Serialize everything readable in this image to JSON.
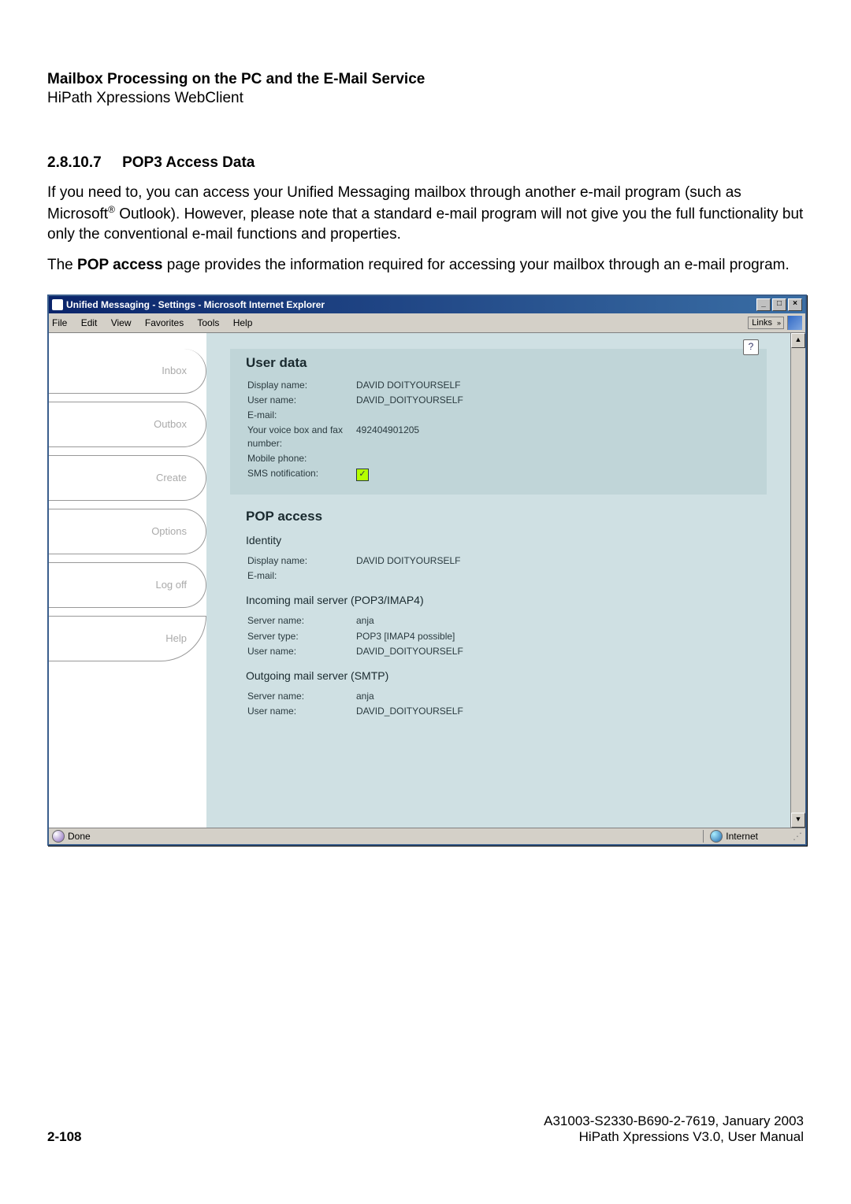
{
  "doc": {
    "chapter_title": "Mailbox Processing on the PC and the E-Mail Service",
    "chapter_sub": "HiPath Xpressions WebClient",
    "section_num": "2.8.10.7",
    "section_title": "POP3 Access Data",
    "para1_a": "If you need to, you can access your Unified Messaging mailbox through another e-mail program (such as Microsoft",
    "para1_sup": "®",
    "para1_b": " Outlook). However, please note that a standard e-mail program will not give you the full functionality but only the conventional e-mail functions and properties.",
    "para2_a": "The ",
    "para2_bold": "POP access",
    "para2_b": " page provides the information required for accessing your mailbox through an e-mail program."
  },
  "window": {
    "title": "Unified Messaging - Settings - Microsoft Internet Explorer",
    "menus": [
      "File",
      "Edit",
      "View",
      "Favorites",
      "Tools",
      "Help"
    ],
    "links_label": "Links",
    "help_icon_glyph": "?",
    "min": "_",
    "max": "□",
    "close": "×",
    "scroll_up": "▲",
    "scroll_down": "▼"
  },
  "sidebar": {
    "items": [
      "Inbox",
      "Outbox",
      "Create",
      "Options",
      "Log off",
      "Help"
    ]
  },
  "userdata": {
    "heading": "User data",
    "rows": [
      {
        "label": "Display name:",
        "value": "DAVID DOITYOURSELF"
      },
      {
        "label": "User name:",
        "value": "DAVID_DOITYOURSELF"
      },
      {
        "label": "E-mail:",
        "value": ""
      },
      {
        "label": "Your voice box and fax number:",
        "value": "492404901205"
      },
      {
        "label": "Mobile phone:",
        "value": ""
      }
    ],
    "sms_label": "SMS notification:",
    "sms_check": "✓"
  },
  "pop": {
    "heading": "POP access",
    "identity_head": "Identity",
    "identity_rows": [
      {
        "label": "Display name:",
        "value": "DAVID DOITYOURSELF"
      },
      {
        "label": "E-mail:",
        "value": ""
      }
    ],
    "incoming_head": "Incoming mail server (POP3/IMAP4)",
    "incoming_rows": [
      {
        "label": "Server name:",
        "value": "anja"
      },
      {
        "label": "Server type:",
        "value": "POP3 [IMAP4 possible]"
      },
      {
        "label": "User name:",
        "value": "DAVID_DOITYOURSELF"
      }
    ],
    "outgoing_head": "Outgoing mail server (SMTP)",
    "outgoing_rows": [
      {
        "label": "Server name:",
        "value": "anja"
      },
      {
        "label": "User name:",
        "value": "DAVID_DOITYOURSELF"
      }
    ]
  },
  "status": {
    "done": "Done",
    "zone": "Internet"
  },
  "footer": {
    "page": "2-108",
    "docnum": "A31003-S2330-B690-2-7619, January 2003",
    "product": "HiPath Xpressions V3.0, User Manual"
  }
}
